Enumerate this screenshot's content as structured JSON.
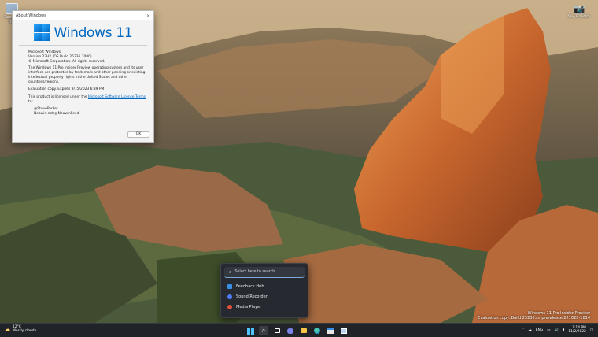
{
  "desktop": {
    "icons": [
      {
        "label": "Recycle Bin"
      }
    ]
  },
  "snip_widget": {
    "label": "Snip & Sketch"
  },
  "about_dialog": {
    "title": "About Windows",
    "logo_text": "Windows 11",
    "product": "Microsoft Windows",
    "version": "Version 22H2 (OS Build 25236.1000)",
    "copyright": "© Microsoft Corporation. All rights reserved.",
    "legal": "The Windows 11 Pro Insider Preview operating system and its user interface are protected by trademark and other pending or existing intellectual property rights in the United States and other countries/regions.",
    "evaluation": "Evaluation copy. Expires 9/15/2023 6:39 PM",
    "license_prefix": "This product is licensed under the ",
    "license_link": "Microsoft Software License Terms",
    "license_suffix": " to:",
    "licensees": [
      "@SteveParker",
      "Neowin.net @NeowinFeed"
    ],
    "ok_label": "OK"
  },
  "search_flyout": {
    "placeholder": "Select here to search",
    "results": [
      {
        "label": "Feedback Hub",
        "icon": "feedback-hub-icon",
        "color": "#3a8ee6"
      },
      {
        "label": "Sound Recorder",
        "icon": "sound-recorder-icon",
        "color": "#4f7cff"
      },
      {
        "label": "Media Player",
        "icon": "media-player-icon",
        "color": "#e0503c"
      }
    ]
  },
  "watermark": {
    "line1": "Windows 11 Pro Insider Preview",
    "line2": "Evaluation copy. Build 25236.rs_prerelease.221028-1814"
  },
  "taskbar": {
    "weather_temp": "12°C",
    "weather_desc": "Mostly cloudy",
    "language": "ENG",
    "time": "7:14 PM",
    "date": "11/2/2022",
    "apps": [
      {
        "name": "start-button",
        "icon": "windows-logo-icon"
      },
      {
        "name": "search-button",
        "icon": "search-icon",
        "active": true
      },
      {
        "name": "task-view-button",
        "icon": "task-view-icon"
      },
      {
        "name": "chat-button",
        "icon": "chat-icon"
      },
      {
        "name": "file-explorer-button",
        "icon": "folder-icon"
      },
      {
        "name": "edge-button",
        "icon": "edge-icon"
      },
      {
        "name": "store-button",
        "icon": "store-icon"
      },
      {
        "name": "winver-button",
        "icon": "about-windows-icon"
      }
    ]
  },
  "colors": {
    "accent": "#0067c0",
    "taskbar": "#202327",
    "flyout": "#262a30"
  }
}
